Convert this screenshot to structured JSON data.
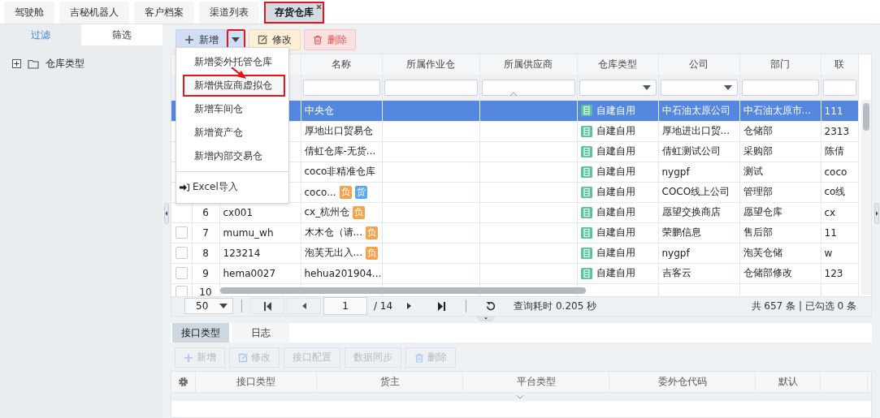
{
  "tabs": [
    {
      "label": "驾驶舱",
      "selected": false,
      "highlighted": false,
      "closable": false
    },
    {
      "label": "吉秘机器人",
      "selected": false,
      "highlighted": false,
      "closable": false
    },
    {
      "label": "客户档案",
      "selected": false,
      "highlighted": false,
      "closable": false
    },
    {
      "label": "渠道列表",
      "selected": false,
      "highlighted": false,
      "closable": false
    },
    {
      "label": "存货仓库",
      "selected": true,
      "highlighted": true,
      "closable": true
    }
  ],
  "sidebar": {
    "tabs": [
      {
        "label": "过滤",
        "selected": true
      },
      {
        "label": "筛选",
        "selected": false
      }
    ],
    "tree": [
      {
        "label": "仓库类型",
        "expanded": false
      }
    ]
  },
  "toolbar": {
    "buttons": [
      {
        "label": "新增",
        "kind": "add",
        "highlighted": false
      },
      {
        "kind": "caret",
        "highlighted": true
      },
      {
        "label": "修改",
        "kind": "edit",
        "highlighted": false
      },
      {
        "label": "删除",
        "kind": "delete",
        "highlighted": false
      }
    ]
  },
  "menu": {
    "items": [
      {
        "label": "新增委外托管仓库",
        "kind": "action",
        "highlighted": false
      },
      {
        "label": "新增供应商虚拟仓",
        "kind": "action",
        "highlighted": true
      },
      {
        "label": "新增车间仓",
        "kind": "action",
        "highlighted": false
      },
      {
        "label": "新增资产仓",
        "kind": "action",
        "highlighted": false
      },
      {
        "label": "新增内部交易仓",
        "kind": "action",
        "highlighted": false
      },
      {
        "label": "Excel导入",
        "kind": "import",
        "highlighted": false
      }
    ]
  },
  "table": {
    "columns": [
      {},
      {},
      {},
      {
        "label": "名称",
        "dropdown": false
      },
      {
        "label": "所属作业仓",
        "dropdown": false
      },
      {
        "label": "所属供应商",
        "dropdown": false
      },
      {
        "label": "仓库类型",
        "dropdown": true
      },
      {
        "label": "公司",
        "dropdown": true
      },
      {
        "label": "部门",
        "dropdown": false
      },
      {
        "label": "联",
        "dropdown": false
      }
    ],
    "rows": [
      {
        "selected": true,
        "name": "中央仓",
        "type": "自建自用",
        "company": "中石油太原公司",
        "dept": "中石油太原市...",
        "contact": "111"
      },
      {
        "selected": false,
        "name": "厚地出口贸易仓",
        "type": "自建自用",
        "company": "厚地进出口贸...",
        "dept": "仓储部",
        "contact": "2313"
      },
      {
        "selected": false,
        "name": "倩虹仓库-无货...",
        "type": "自建自用",
        "company": "倩虹测试公司",
        "dept": "采购部",
        "contact": "陈倩"
      },
      {
        "selected": false,
        "name": "coco非精准仓库",
        "type": "自建自用",
        "company": "nygpf",
        "dept": "测试",
        "contact": "coco"
      },
      {
        "selected": false,
        "name": "coco...",
        "tags": [
          {
            "text": "负",
            "color": "#f5a24a"
          },
          {
            "text": "货",
            "color": "#5aa9ef"
          }
        ],
        "type": "自建自用",
        "company": "COCO线上公司",
        "dept": "管理部",
        "contact": "co线"
      },
      {
        "selected": false,
        "num": "6",
        "code": "cx001",
        "name": "cx_杭州仓",
        "tags": [
          {
            "text": "负",
            "color": "#f5a24a"
          }
        ],
        "type": "自建自用",
        "company": "愿望交换商店",
        "dept": "愿望仓库",
        "contact": "cx"
      },
      {
        "selected": false,
        "checked": false,
        "num": "7",
        "code": "mumu_wh",
        "name": "木木仓（请...",
        "tags": [
          {
            "text": "负",
            "color": "#f5a24a"
          }
        ],
        "type": "自建自用",
        "company": "荣鹏信息",
        "dept": "售后部",
        "contact": "11"
      },
      {
        "selected": false,
        "checked": false,
        "num": "8",
        "code": "123214",
        "name": "泡芙无出入...",
        "tags": [
          {
            "text": "负",
            "color": "#f5a24a"
          }
        ],
        "type": "自建自用",
        "company": "nygpf",
        "dept": "泡芙仓储",
        "contact": "w"
      },
      {
        "selected": false,
        "checked": false,
        "num": "9",
        "code": "hema0027",
        "name": "hehua201904...",
        "type": "自建自用",
        "company": "吉客云",
        "dept": "仓储部修改",
        "contact": "123"
      },
      {
        "selected": false,
        "checked": false,
        "num": "10"
      }
    ]
  },
  "pager": {
    "page_size": "50",
    "page": "1",
    "total_pages": "/ 14",
    "query_time": "查询耗时 0.205 秒",
    "summary": "共 657 条 | 已勾选 0 条"
  },
  "bottom": {
    "tabs": [
      {
        "label": "接口类型",
        "selected": true
      },
      {
        "label": "日志",
        "selected": false
      }
    ],
    "buttons": [
      {
        "label": "新增",
        "kind": "add",
        "disabled": true
      },
      {
        "label": "修改",
        "kind": "edit",
        "disabled": true
      },
      {
        "label": "接口配置",
        "kind": "plain",
        "disabled": true
      },
      {
        "label": "数据同步",
        "kind": "plain",
        "disabled": true
      },
      {
        "label": "删除",
        "kind": "delete",
        "disabled": true
      }
    ],
    "columns": [
      "接口类型",
      "货主",
      "平台类型",
      "委外仓代码",
      "默认"
    ]
  }
}
